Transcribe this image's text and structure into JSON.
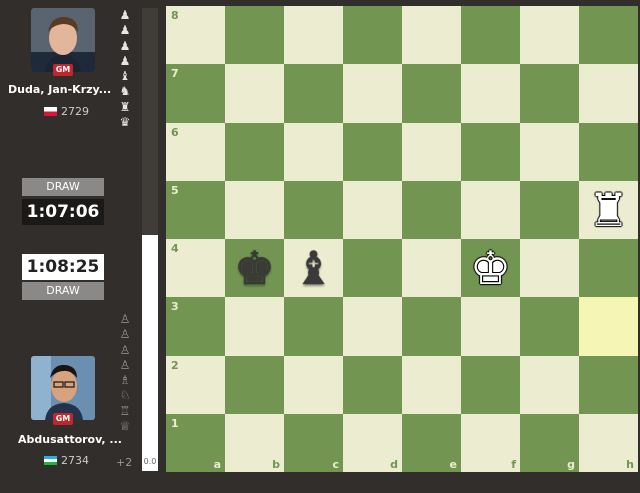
{
  "top_player": {
    "name": "Duda, Jan-Krzy...",
    "title": "GM",
    "rating": "2729",
    "flag_icon": "poland-flag-icon",
    "clock": "1:07:06",
    "draw_label": "DRAW",
    "captured": [
      "♟",
      "♟",
      "♟",
      "♟",
      "♝",
      "♞",
      "♜",
      "♛"
    ]
  },
  "bottom_player": {
    "name": "Abdusattorov, ...",
    "title": "GM",
    "rating": "2734",
    "flag_icon": "uzbekistan-flag-icon",
    "clock": "1:08:25",
    "draw_label": "DRAW",
    "captured": [
      "♙",
      "♙",
      "♙",
      "♙",
      "♗",
      "♘",
      "♖",
      "♕"
    ],
    "material_advantage": "+2"
  },
  "eval": {
    "value": "0.0",
    "white_fraction": 0.5
  },
  "board": {
    "colors": {
      "light": "#ebecd0",
      "dark": "#739552",
      "highlight": "#f5f6b5"
    },
    "ranks": [
      "8",
      "7",
      "6",
      "5",
      "4",
      "3",
      "2",
      "1"
    ],
    "files": [
      "a",
      "b",
      "c",
      "d",
      "e",
      "f",
      "g",
      "h"
    ],
    "highlighted": [
      "h3"
    ],
    "pieces": [
      {
        "square": "h5",
        "glyph": "♜",
        "color": "white",
        "name": "white-rook"
      },
      {
        "square": "b4",
        "glyph": "♚",
        "color": "black",
        "name": "black-king"
      },
      {
        "square": "c4",
        "glyph": "♝",
        "color": "black",
        "name": "black-bishop"
      },
      {
        "square": "f4",
        "glyph": "♚",
        "color": "white",
        "name": "white-king"
      }
    ]
  }
}
